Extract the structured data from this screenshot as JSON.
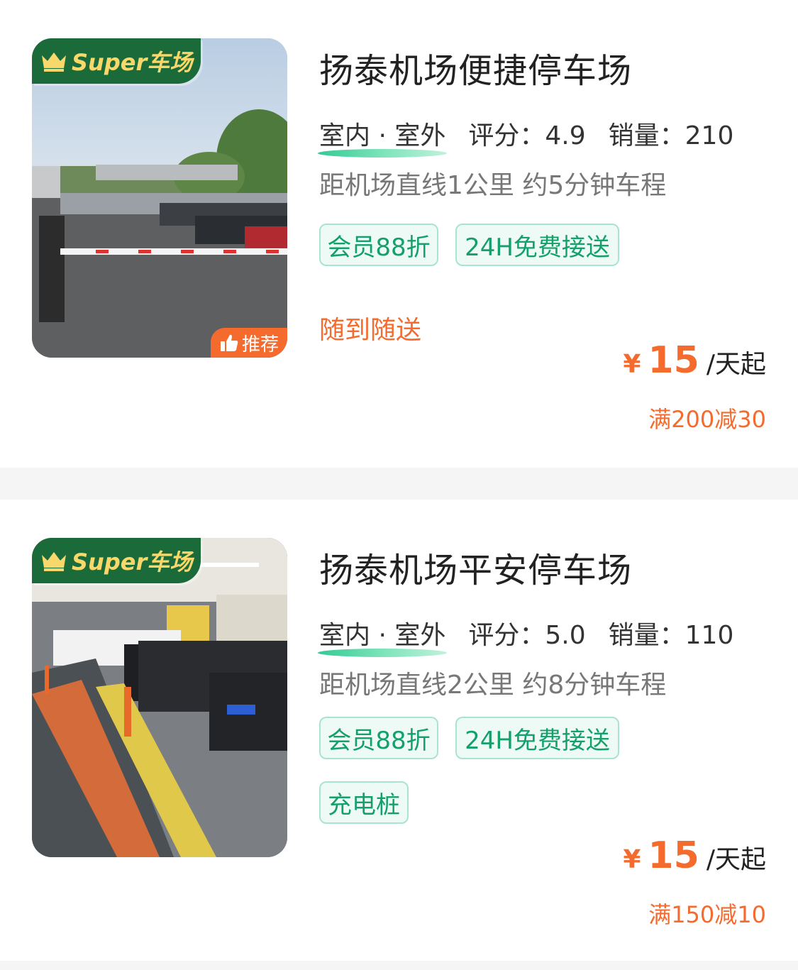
{
  "listings": [
    {
      "badge": "Super车场",
      "recommend": "推荐",
      "title": "扬泰机场便捷停车场",
      "environment": "室内 · 室外",
      "rating_label": "评分：",
      "rating": "4.9",
      "sales_label": "销量：",
      "sales": "210",
      "distance": "距机场直线1公里 约5分钟车程",
      "tags": [
        "会员88折",
        "24H免费接送"
      ],
      "slogan": "随到随送",
      "price_symbol": "¥",
      "price": "15",
      "price_unit": "/天起",
      "discount": "满200减30"
    },
    {
      "badge": "Super车场",
      "title": "扬泰机场平安停车场",
      "environment": "室内 · 室外",
      "rating_label": "评分：",
      "rating": "5.0",
      "sales_label": "销量：",
      "sales": "110",
      "distance": "距机场直线2公里 约8分钟车程",
      "tags": [
        "会员88折",
        "24H免费接送",
        "充电桩"
      ],
      "price_symbol": "¥",
      "price": "15",
      "price_unit": "/天起",
      "discount": "满150减10"
    }
  ],
  "colors": {
    "accent": "#f46b2d",
    "tag_green": "#13a06b",
    "badge_green": "#1b6b3a",
    "badge_gold": "#f9d86b"
  }
}
